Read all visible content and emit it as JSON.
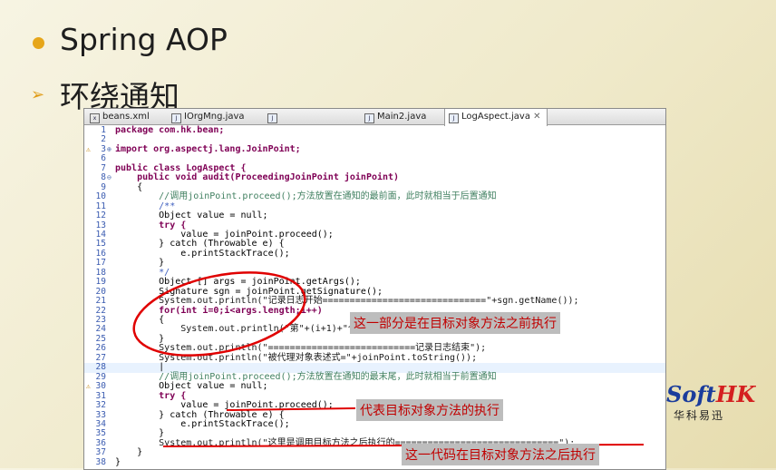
{
  "slide": {
    "title": "Spring AOP",
    "subtitle": "环绕通知"
  },
  "editor": {
    "tabs": [
      {
        "label": "beans.xml",
        "icon": "xml-file-icon"
      },
      {
        "label": "IOrgMng.java",
        "icon": "java-file-icon"
      },
      {
        "label": "",
        "icon": "java-file-icon"
      },
      {
        "label": "Main2.java",
        "icon": "java-file-icon"
      },
      {
        "label": "LogAspect.java",
        "icon": "java-file-icon",
        "active": true,
        "close": "✕"
      }
    ],
    "lines": [
      {
        "n": "1",
        "t": "package com.hk.bean;"
      },
      {
        "n": "2",
        "t": ""
      },
      {
        "n": "3",
        "t": "import org.aspectj.lang.JoinPoint;"
      },
      {
        "n": "6",
        "t": ""
      },
      {
        "n": "7",
        "t": "public class LogAspect {"
      },
      {
        "n": "8",
        "t": "    public void audit(ProceedingJoinPoint joinPoint)"
      },
      {
        "n": "9",
        "t": "    {"
      },
      {
        "n": "10",
        "t": "        //调用joinPoint.proceed();方法放置在通知的最前面，此时就相当于后置通知"
      },
      {
        "n": "11",
        "t": "        /**"
      },
      {
        "n": "12",
        "t": "        Object value = null;"
      },
      {
        "n": "13",
        "t": "        try {"
      },
      {
        "n": "14",
        "t": "            value = joinPoint.proceed();"
      },
      {
        "n": "15",
        "t": "        } catch (Throwable e) {"
      },
      {
        "n": "16",
        "t": "            e.printStackTrace();"
      },
      {
        "n": "17",
        "t": "        }"
      },
      {
        "n": "18",
        "t": "        */"
      },
      {
        "n": "19",
        "t": "        Object [] args = joinPoint.getArgs();"
      },
      {
        "n": "20",
        "t": "        Signature sgn = joinPoint.getSignature();"
      },
      {
        "n": "21",
        "t": "        System.out.println(\"记录日志开始==============================\"+sgn.getName());"
      },
      {
        "n": "22",
        "t": "        for(int i=0;i<args.length;i++)"
      },
      {
        "n": "23",
        "t": "        {"
      },
      {
        "n": "24",
        "t": "            System.out.println(\"第\"+(i+1)+\"个参数=\"+args[i]);"
      },
      {
        "n": "25",
        "t": "        }"
      },
      {
        "n": "26",
        "t": "        System.out.println(\"===========================记录日志结束\");"
      },
      {
        "n": "27",
        "t": "        System.out.println(\"被代理对象表述式=\"+joinPoint.toString());"
      },
      {
        "n": "28",
        "t": "        |"
      },
      {
        "n": "29",
        "t": "        //调用joinPoint.proceed();方法放置在通知的最末尾，此时就相当于前置通知"
      },
      {
        "n": "30",
        "t": "        Object value = null;"
      },
      {
        "n": "31",
        "t": "        try {"
      },
      {
        "n": "32",
        "t": "            value = joinPoint.proceed();"
      },
      {
        "n": "33",
        "t": "        } catch (Throwable e) {"
      },
      {
        "n": "34",
        "t": "            e.printStackTrace();"
      },
      {
        "n": "35",
        "t": "        }"
      },
      {
        "n": "36",
        "t": "        System.out.println(\"这里是调用目标方法之后执行的==============================\");"
      },
      {
        "n": "37",
        "t": "    }"
      },
      {
        "n": "38",
        "t": "}"
      }
    ]
  },
  "annotations": {
    "before": "这一部分是在目标对象方法之前执行",
    "target": "代表目标对象方法的执行",
    "after": "这一代码在目标对象方法之后执行"
  },
  "logo": {
    "soft": "Soft",
    "hk": "HK",
    "cn": "华科易迅"
  },
  "colors": {
    "bullet": "#e6a61a",
    "annotation_text": "#c00000",
    "circle": "#e00000",
    "keyword": "#7f0055",
    "comment": "#3f7f5f",
    "string": "#2a00ff"
  }
}
